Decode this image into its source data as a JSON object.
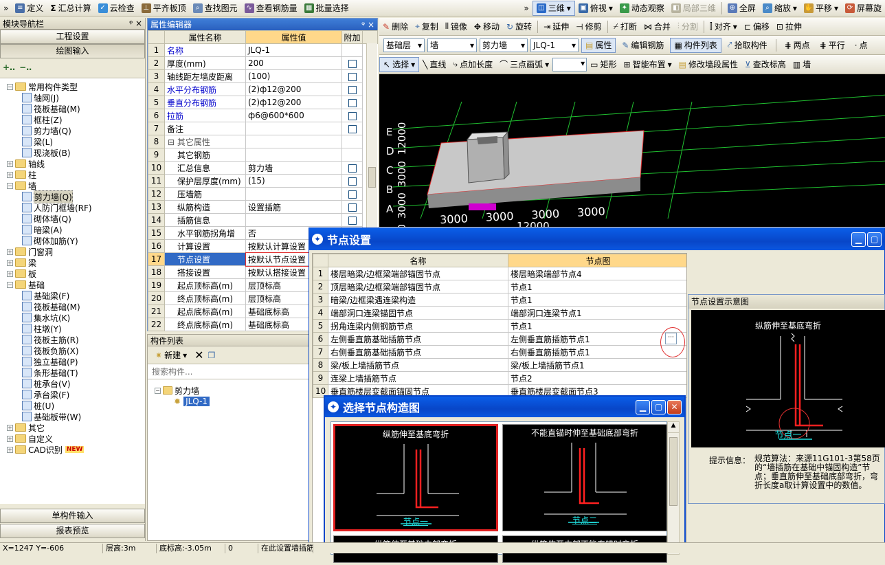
{
  "toolbar1": {
    "items": [
      "定义",
      "汇总计算",
      "云检查",
      "平齐板顶",
      "查找图元",
      "查看钢筋量",
      "批量选择"
    ],
    "right": [
      "三维",
      "俯视",
      "动态观察",
      "局部三维",
      "全屏",
      "缩放",
      "平移",
      "屏幕旋"
    ]
  },
  "toolbar2": [
    "删除",
    "复制",
    "镜像",
    "移动",
    "旋转",
    "延伸",
    "修剪",
    "打断",
    "合并",
    "分割",
    "对齐",
    "偏移",
    "拉伸"
  ],
  "toolbar3": {
    "layer": "基础层",
    "type": "墙",
    "cat": "剪力墙",
    "comp": "JLQ-1",
    "items": [
      "属性",
      "编辑钢筋",
      "构件列表",
      "拾取构件",
      "两点",
      "平行",
      "点"
    ]
  },
  "toolbar4": [
    "选择",
    "直线",
    "点加长度",
    "三点画弧",
    "矩形",
    "智能布置",
    "修改墙段属性",
    "查改标高",
    "墙"
  ],
  "nav": {
    "title": "模块导航栏",
    "pin": "ᵠ ×",
    "btn_project": "工程设置",
    "btn_draw": "绘图输入",
    "tree": [
      {
        "lvl": 0,
        "tog": "−",
        "folder": true,
        "t": "常用构件类型"
      },
      {
        "lvl": 1,
        "t": "轴网(J)"
      },
      {
        "lvl": 1,
        "t": "筏板基础(M)"
      },
      {
        "lvl": 1,
        "t": "框柱(Z)"
      },
      {
        "lvl": 1,
        "t": "剪力墙(Q)"
      },
      {
        "lvl": 1,
        "t": "梁(L)"
      },
      {
        "lvl": 1,
        "t": "现浇板(B)"
      },
      {
        "lvl": 0,
        "tog": "+",
        "folder": true,
        "t": "轴线"
      },
      {
        "lvl": 0,
        "tog": "+",
        "folder": true,
        "t": "柱"
      },
      {
        "lvl": 0,
        "tog": "−",
        "folder": true,
        "t": "墙"
      },
      {
        "lvl": 1,
        "t": "剪力墙(Q)",
        "sel": true
      },
      {
        "lvl": 1,
        "t": "人防门框墙(RF)"
      },
      {
        "lvl": 1,
        "t": "砌体墙(Q)"
      },
      {
        "lvl": 1,
        "t": "暗梁(A)"
      },
      {
        "lvl": 1,
        "t": "砌体加筋(Y)"
      },
      {
        "lvl": 0,
        "tog": "+",
        "folder": true,
        "t": "门窗洞"
      },
      {
        "lvl": 0,
        "tog": "+",
        "folder": true,
        "t": "梁"
      },
      {
        "lvl": 0,
        "tog": "+",
        "folder": true,
        "t": "板"
      },
      {
        "lvl": 0,
        "tog": "−",
        "folder": true,
        "t": "基础"
      },
      {
        "lvl": 1,
        "t": "基础梁(F)"
      },
      {
        "lvl": 1,
        "t": "筏板基础(M)"
      },
      {
        "lvl": 1,
        "t": "集水坑(K)"
      },
      {
        "lvl": 1,
        "t": "柱墩(Y)"
      },
      {
        "lvl": 1,
        "t": "筏板主筋(R)"
      },
      {
        "lvl": 1,
        "t": "筏板负筋(X)"
      },
      {
        "lvl": 1,
        "t": "独立基础(P)"
      },
      {
        "lvl": 1,
        "t": "条形基础(T)"
      },
      {
        "lvl": 1,
        "t": "桩承台(V)"
      },
      {
        "lvl": 1,
        "t": "承台梁(F)"
      },
      {
        "lvl": 1,
        "t": "桩(U)"
      },
      {
        "lvl": 1,
        "t": "基础板带(W)"
      },
      {
        "lvl": 0,
        "tog": "+",
        "folder": true,
        "t": "其它"
      },
      {
        "lvl": 0,
        "tog": "+",
        "folder": true,
        "t": "自定义"
      },
      {
        "lvl": 0,
        "tog": "+",
        "folder": true,
        "t": "CAD识别",
        "badge": "NEW"
      }
    ],
    "btn_single": "单构件输入",
    "btn_report": "报表预览"
  },
  "props": {
    "title": "属性编辑器",
    "col_name": "属性名称",
    "col_val": "属性值",
    "col_add": "附加",
    "rows": [
      {
        "n": "1",
        "name": "名称",
        "v": "JLQ-1",
        "blue": true,
        "cb": false
      },
      {
        "n": "2",
        "name": "厚度(mm)",
        "v": "200",
        "cb": true
      },
      {
        "n": "3",
        "name": "轴线距左墙皮距离",
        "v": "(100)",
        "cb": true
      },
      {
        "n": "4",
        "name": "水平分布钢筋",
        "v": "(2)ф12@200",
        "blue": true,
        "cb": true
      },
      {
        "n": "5",
        "name": "垂直分布钢筋",
        "v": "(2)ф12@200",
        "blue": true,
        "cb": true
      },
      {
        "n": "6",
        "name": "拉筋",
        "v": "ф6@600*600",
        "blue": true,
        "cb": true
      },
      {
        "n": "7",
        "name": "备注",
        "v": "",
        "cb": true
      },
      {
        "n": "8",
        "name": "其它属性",
        "v": "",
        "group": true
      },
      {
        "n": "9",
        "name": "其它钢筋",
        "v": "",
        "ind": true
      },
      {
        "n": "10",
        "name": "汇总信息",
        "v": "剪力墙",
        "ind": true,
        "cb": true
      },
      {
        "n": "11",
        "name": "保护层厚度(mm)",
        "v": "(15)",
        "ind": true,
        "cb": true
      },
      {
        "n": "12",
        "name": "压墙筋",
        "v": "",
        "ind": true,
        "cb": true
      },
      {
        "n": "13",
        "name": "纵筋构造",
        "v": "设置插筋",
        "ind": true,
        "cb": true
      },
      {
        "n": "14",
        "name": "插筋信息",
        "v": "",
        "ind": true,
        "cb": true
      },
      {
        "n": "15",
        "name": "水平钢筋拐角增",
        "v": "否",
        "ind": true,
        "cb": true
      },
      {
        "n": "16",
        "name": "计算设置",
        "v": "按默认计算设置",
        "ind": true
      },
      {
        "n": "17",
        "name": "节点设置",
        "v": "按默认节点设置",
        "ind": true,
        "sel": true
      },
      {
        "n": "18",
        "name": "搭接设置",
        "v": "按默认搭接设置",
        "ind": true
      },
      {
        "n": "19",
        "name": "起点顶标高(m)",
        "v": "层顶标高",
        "ind": true
      },
      {
        "n": "20",
        "name": "终点顶标高(m)",
        "v": "层顶标高",
        "ind": true
      },
      {
        "n": "21",
        "name": "起点底标高(m)",
        "v": "基础底标高",
        "ind": true
      },
      {
        "n": "22",
        "name": "终点底标高(m)",
        "v": "基础底标高",
        "ind": true
      }
    ]
  },
  "complist": {
    "title": "构件列表",
    "new": "新建",
    "search_ph": "搜索构件...",
    "root": "剪力墙",
    "child": "JLQ-1"
  },
  "view3d": {
    "axis_left": [
      "E",
      "D",
      "C",
      "B",
      "A"
    ],
    "axis_vert": [
      "3000",
      "3000",
      "3000",
      "12000"
    ],
    "axis_bottom": [
      "3000",
      "3000",
      "3000",
      "3000"
    ],
    "total": "12000"
  },
  "node_dlg": {
    "title": "节点设置",
    "col_name": "名称",
    "col_img": "节点图",
    "rows": [
      {
        "n": "1",
        "a": "楼层暗梁/边框梁端部锚固节点",
        "b": "楼层暗梁端部节点4"
      },
      {
        "n": "2",
        "a": "顶层暗梁/边框梁端部锚固节点",
        "b": "节点1"
      },
      {
        "n": "3",
        "a": "暗梁/边框梁遇连梁构造",
        "b": "节点1"
      },
      {
        "n": "4",
        "a": "端部洞口连梁锚固节点",
        "b": "端部洞口连梁节点1"
      },
      {
        "n": "5",
        "a": "拐角连梁内侧钢筋节点",
        "b": "节点1"
      },
      {
        "n": "6",
        "a": "左侧垂直筋基础插筋节点",
        "b": "左侧垂直筋插筋节点1"
      },
      {
        "n": "7",
        "a": "右侧垂直筋基础插筋节点",
        "b": "右侧垂直筋插筋节点1"
      },
      {
        "n": "8",
        "a": "梁/板上墙插筋节点",
        "b": "梁/板上墙插筋节点1"
      },
      {
        "n": "9",
        "a": "连梁上墙插筋节点",
        "b": "节点2"
      },
      {
        "n": "10",
        "a": "垂直筋楼层变截面锚固节点",
        "b": "垂直筋楼层变截面节点3"
      }
    ],
    "ellipsis": "···"
  },
  "preview": {
    "title": "节点设置示意图",
    "caption": "纵筋伸至基底弯折",
    "label": "节点一",
    "hint_label": "提示信息：",
    "hint": "规范算法：来源11G101-3第58页的“墙插筋在基础中锚固构造”节点；垂直筋伸至基础底部弯折，弯折长度a取计算设置中的数值。"
  },
  "select_dlg": {
    "title": "选择节点构造图",
    "cells": [
      {
        "cap": "纵筋伸至基底弯折",
        "lab": "节点一"
      },
      {
        "cap": "不能直锚时伸至基础底部弯折",
        "lab": "节点二"
      },
      {
        "cap": "纵筋伸至基础中部弯折",
        "lab": ""
      },
      {
        "cap": "纵筋伸至中部不能直锚时弯折",
        "lab": ""
      }
    ]
  },
  "status": [
    "X=1247 Y=-606",
    "层高:3m",
    "底标高:-3.05m",
    "0",
    "在此设置墙插筋"
  ]
}
